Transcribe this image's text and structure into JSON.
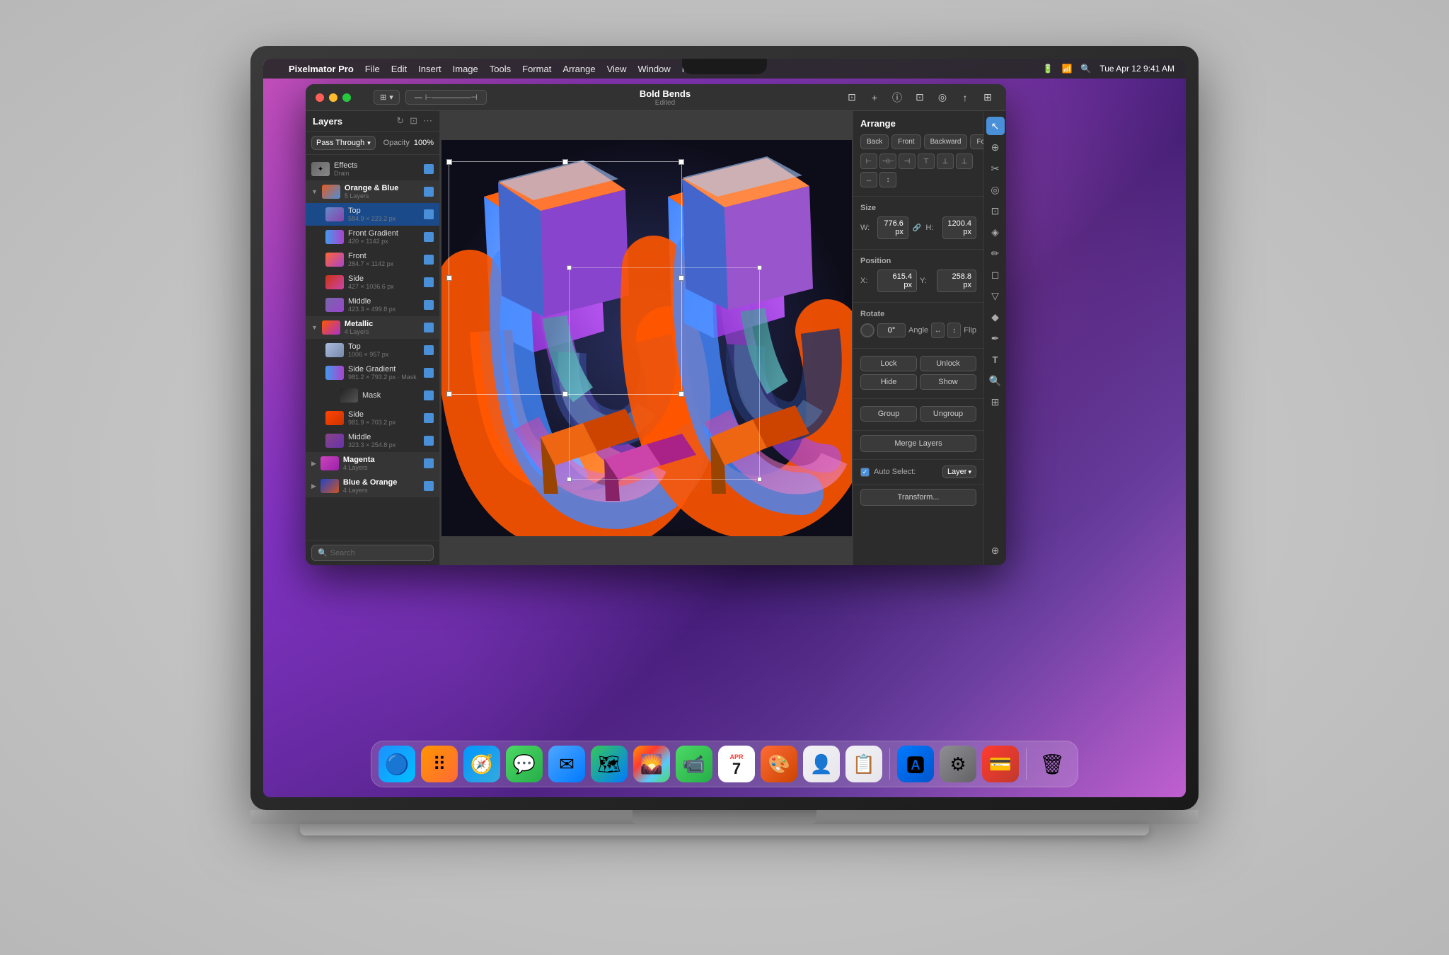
{
  "menubar": {
    "apple": "",
    "app_name": "Pixelmator Pro",
    "menu_items": [
      "File",
      "Edit",
      "Insert",
      "Image",
      "Tools",
      "Format",
      "Arrange",
      "View",
      "Window",
      "Help"
    ],
    "time": "Tue Apr 12  9:41 AM"
  },
  "titlebar": {
    "doc_title": "Bold Bends",
    "doc_status": "Edited"
  },
  "layers_panel": {
    "title": "Layers",
    "blend_mode": "Pass Through",
    "opacity_label": "Opacity",
    "opacity_value": "100%",
    "search_placeholder": "Search",
    "layers": [
      {
        "name": "Effects",
        "sub": "Drain",
        "type": "effects",
        "indent": 0,
        "visible": true
      },
      {
        "name": "Orange & Blue",
        "sub": "5 Layers",
        "type": "group",
        "indent": 0,
        "visible": true,
        "expanded": true
      },
      {
        "name": "Top",
        "sub": "584.9 × 223.2 px",
        "type": "layer",
        "indent": 1,
        "visible": true
      },
      {
        "name": "Front Gradient",
        "sub": "420 × 1142 px",
        "type": "layer",
        "indent": 1,
        "visible": true
      },
      {
        "name": "Front",
        "sub": "284.7 × 1142 px",
        "type": "layer",
        "indent": 1,
        "visible": true
      },
      {
        "name": "Side",
        "sub": "427 × 1036.6 px",
        "type": "layer",
        "indent": 1,
        "visible": true
      },
      {
        "name": "Middle",
        "sub": "423.3 × 499.8 px",
        "type": "layer",
        "indent": 1,
        "visible": true
      },
      {
        "name": "Metallic",
        "sub": "4 Layers",
        "type": "group",
        "indent": 0,
        "visible": true,
        "expanded": true
      },
      {
        "name": "Top",
        "sub": "1006 × 957 px",
        "type": "layer",
        "indent": 1,
        "visible": true
      },
      {
        "name": "Side Gradient",
        "sub": "981.2 × 793.2 px · Mask",
        "type": "layer",
        "indent": 1,
        "visible": true
      },
      {
        "name": "Mask",
        "sub": "",
        "type": "mask",
        "indent": 1,
        "visible": true
      },
      {
        "name": "Side",
        "sub": "981.9 × 703.2 px",
        "type": "layer",
        "indent": 1,
        "visible": true
      },
      {
        "name": "Middle",
        "sub": "323.3 × 254.8 px",
        "type": "layer",
        "indent": 1,
        "visible": true
      },
      {
        "name": "Magenta",
        "sub": "4 Layers",
        "type": "group",
        "indent": 0,
        "visible": true
      },
      {
        "name": "Blue & Orange",
        "sub": "4 Layers",
        "type": "group",
        "indent": 0,
        "visible": true
      }
    ]
  },
  "arrange_panel": {
    "title": "Arrange",
    "back_label": "Back",
    "front_label": "Front",
    "backward_label": "Backward",
    "forward_label": "Forward",
    "size": {
      "w_label": "W:",
      "w_value": "776.6 px",
      "h_label": "H:",
      "h_value": "1200.4 px"
    },
    "position": {
      "x_label": "X:",
      "x_value": "615.4 px",
      "y_label": "Y:",
      "y_value": "258.8 px"
    },
    "rotate": {
      "angle_label": "Angle",
      "angle_value": "0°",
      "flip_label": "Flip"
    },
    "lock_label": "Lock",
    "unlock_label": "Unlock",
    "hide_label": "Hide",
    "show_label": "Show",
    "group_label": "Group",
    "ungroup_label": "Ungroup",
    "merge_layers_label": "Merge Layers",
    "auto_select_label": "Auto Select:",
    "auto_select_value": "Layer",
    "transform_label": "Transform..."
  },
  "dock": {
    "items": [
      {
        "name": "Finder",
        "icon": "🔵",
        "color": "#1e90ff"
      },
      {
        "name": "Launchpad",
        "icon": "🚀",
        "color": "#ff6b35"
      },
      {
        "name": "Safari",
        "icon": "🧭",
        "color": "#0096ff"
      },
      {
        "name": "Messages",
        "icon": "💬",
        "color": "#4cd964"
      },
      {
        "name": "Mail",
        "icon": "📧",
        "color": "#4da6ff"
      },
      {
        "name": "Maps",
        "icon": "🗺️",
        "color": "#4cd964"
      },
      {
        "name": "Photos",
        "icon": "🌄",
        "color": "#ff9500"
      },
      {
        "name": "FaceTime",
        "icon": "📹",
        "color": "#4cd964"
      },
      {
        "name": "Calendar",
        "icon": "📅",
        "color": "#ff3b30"
      },
      {
        "name": "Pixelmator",
        "icon": "🎨",
        "color": "#ff6b35"
      },
      {
        "name": "Contacts",
        "icon": "👤",
        "color": "#8e8e93"
      },
      {
        "name": "Reminders",
        "icon": "📋",
        "color": "#ff3b30"
      },
      {
        "name": "App Store",
        "icon": "🅰️",
        "color": "#007aff"
      },
      {
        "name": "System Preferences",
        "icon": "⚙️",
        "color": "#8e8e93"
      },
      {
        "name": "Wallet",
        "icon": "💳",
        "color": "#ff3b30"
      },
      {
        "name": "Trash",
        "icon": "🗑️",
        "color": "#8e8e93"
      }
    ]
  }
}
